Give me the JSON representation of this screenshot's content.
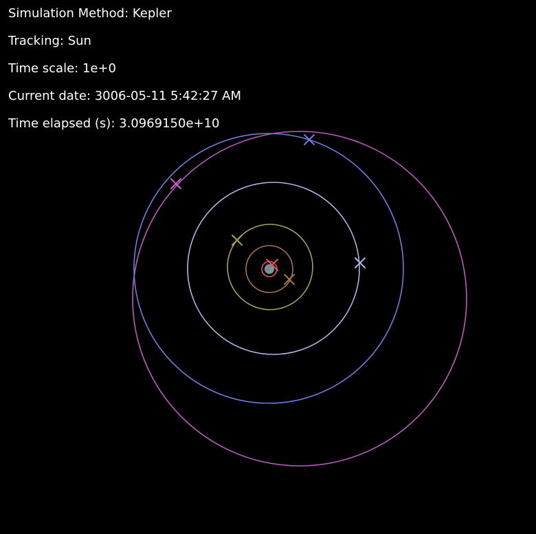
{
  "hud": {
    "method_label": "Simulation Method: Kepler",
    "tracking_label": "Tracking: Sun",
    "time_scale_label": "Time scale: 1e+0",
    "current_date_label": "Current date: 3006-05-11 5:42:27 AM",
    "time_elapsed_label": "Time elapsed (s): 3.0969150e+10"
  },
  "colors": {
    "background": "#000000",
    "text": "#ffffff",
    "sun": "#5fa3a0",
    "mercury": "#e8506a",
    "venus": "#a8734e",
    "earth": "#a7a155",
    "mars": "#aab8e4",
    "neptune_like": "#6f7ee0",
    "pluto_like": "#c05ac0"
  },
  "bodies": [
    {
      "id": "sun",
      "icon": "sun-dot-icon"
    },
    {
      "id": "mercury",
      "icon": "x-marker-icon"
    },
    {
      "id": "venus",
      "icon": "x-marker-icon"
    },
    {
      "id": "earth",
      "icon": "x-marker-icon"
    },
    {
      "id": "mars",
      "icon": "x-marker-icon"
    },
    {
      "id": "outer-blue",
      "icon": "x-marker-icon"
    },
    {
      "id": "outer-magenta",
      "icon": "x-marker-icon"
    }
  ]
}
